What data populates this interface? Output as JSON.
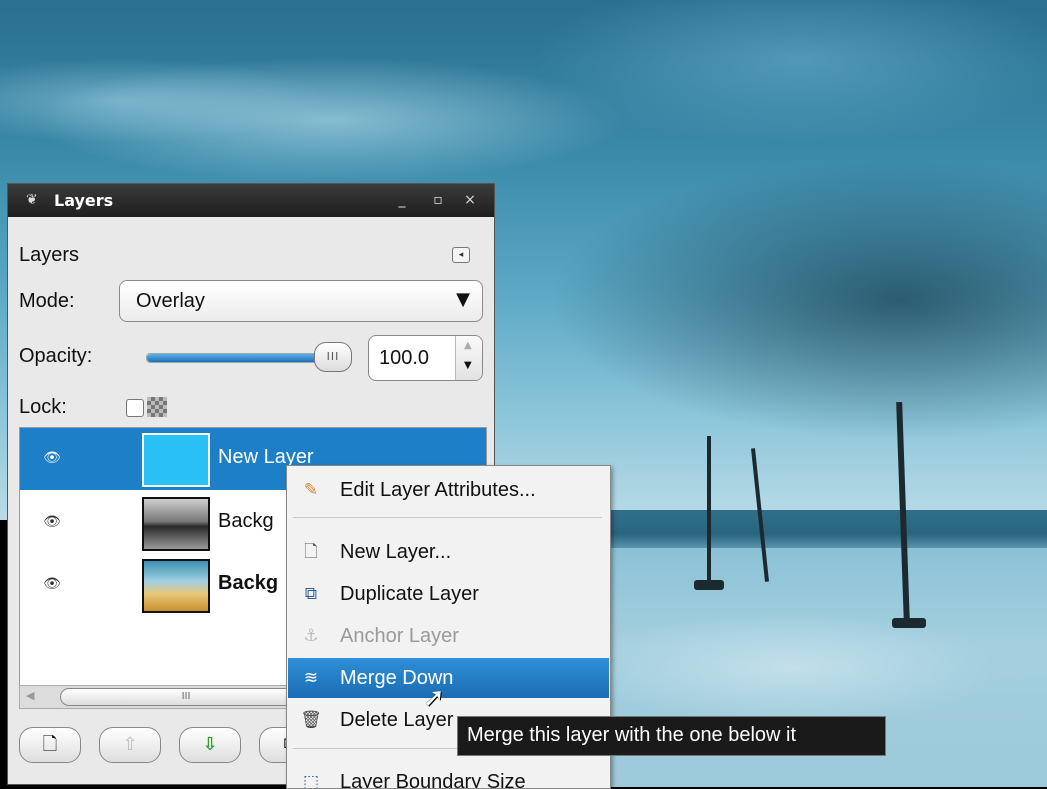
{
  "window": {
    "title": "Layers",
    "minimize_glyph": "_",
    "maximize_glyph": "▫",
    "close_glyph": "×"
  },
  "panel": {
    "title": "Layers",
    "menu_glyph": "◂"
  },
  "mode": {
    "label": "Mode:",
    "value": "Overlay",
    "arrow_glyph": "▼"
  },
  "opacity": {
    "label": "Opacity:",
    "value": "100.0",
    "fraction": 1.0,
    "handle_glyph": "III"
  },
  "lock": {
    "label": "Lock:",
    "checked": false
  },
  "layers": [
    {
      "name": "New Layer",
      "selected": true,
      "visible": true,
      "thumb": "solid-cyan"
    },
    {
      "name": "Backg",
      "selected": false,
      "visible": true,
      "thumb": "grey-photo"
    },
    {
      "name": "Backg",
      "selected": false,
      "visible": true,
      "thumb": "color-photo",
      "bold": true
    }
  ],
  "scrollbar": {
    "left_glyph": "◀",
    "thumb_glyph": "III"
  },
  "toolbar": [
    {
      "name": "new-layer-button",
      "glyph": "🗋"
    },
    {
      "name": "raise-layer-button",
      "glyph": "⇧"
    },
    {
      "name": "lower-layer-button",
      "glyph": "⇩"
    },
    {
      "name": "duplicate-layer-button",
      "glyph": "⧉"
    }
  ],
  "context_menu": {
    "items": [
      {
        "label": "Edit Layer Attributes...",
        "icon": "pencil-icon",
        "glyph": "✎"
      },
      {
        "label": "New Layer...",
        "icon": "new-document-icon",
        "glyph": "🗋"
      },
      {
        "label": "Duplicate Layer",
        "icon": "duplicate-icon",
        "glyph": "⧉"
      },
      {
        "label": "Anchor Layer",
        "icon": "anchor-icon",
        "glyph": "⚓",
        "disabled": true
      },
      {
        "label": "Merge Down",
        "icon": "merge-icon",
        "glyph": "≋",
        "highlighted": true
      },
      {
        "label": "Delete Layer",
        "icon": "trash-icon",
        "glyph": "🗑"
      },
      {
        "label": "Layer Boundary Size",
        "icon": "boundary-icon",
        "glyph": "⬚"
      }
    ]
  },
  "tooltip": {
    "text": "Merge this layer with the one below it"
  },
  "colors": {
    "selection": "#1d7fc8",
    "menu_highlight": "#1a6db3",
    "titlebar": "#1e1e1e",
    "new_layer_fill": "#29c0f5"
  }
}
